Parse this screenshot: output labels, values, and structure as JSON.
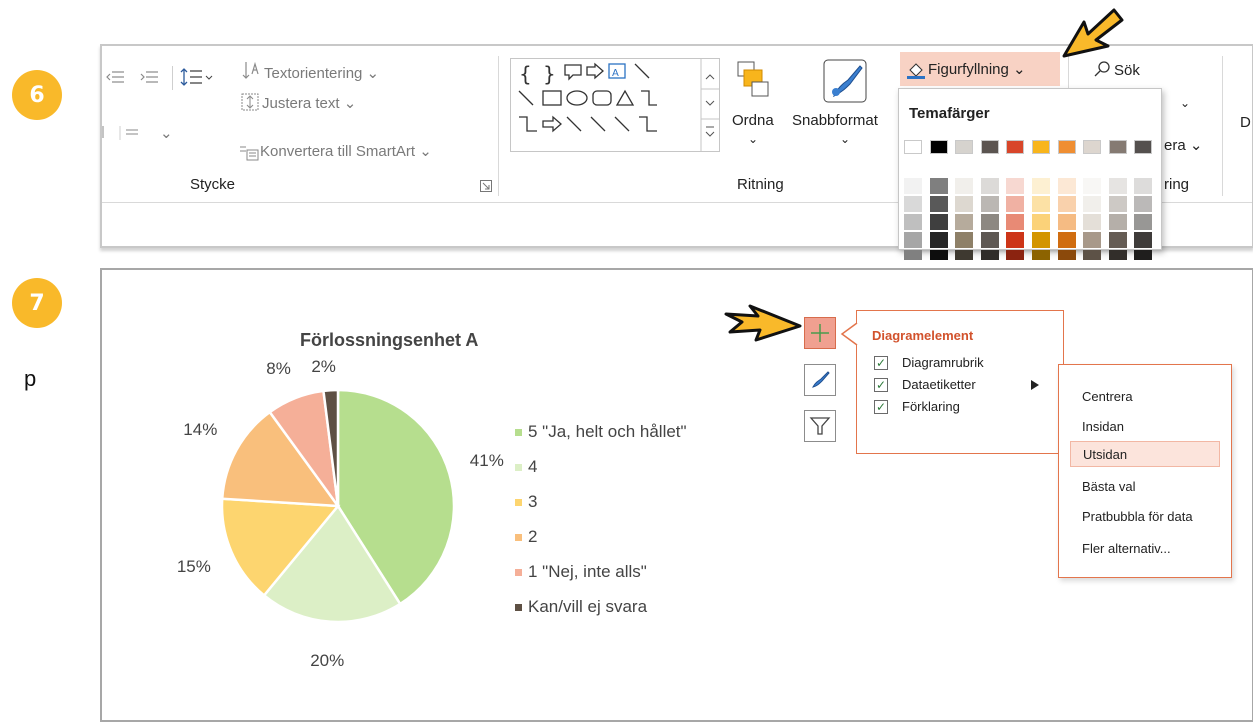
{
  "steps": {
    "six": "6",
    "seven": "7"
  },
  "side_letter": "p",
  "ribbon": {
    "text_direction": "Textorientering",
    "align_text": "Justera text",
    "smartart": "Konvertera till SmartArt",
    "group_paragraph": "Stycke",
    "group_drawing": "Ritning",
    "arrange": "Ordna",
    "quick_styles": "Snabbformat",
    "shape_fill": "Figurfyllning",
    "search": "Sök",
    "partial_era": "era",
    "partial_ring": "ring",
    "partial_d": "D"
  },
  "fill_menu": {
    "title": "Temafärger",
    "theme_colors": [
      "#ffffff",
      "#000000",
      "#d6d3ce",
      "#5b5450",
      "#d8462a",
      "#f8b51c",
      "#ef8e32",
      "#ddd6cf",
      "#857a72",
      "#54504e"
    ],
    "shade_columns": [
      [
        "#f2f2f2",
        "#d9d9d9",
        "#bfbfbf",
        "#a6a6a6",
        "#808080"
      ],
      [
        "#7f7f7f",
        "#595959",
        "#3f3f3f",
        "#262626",
        "#0d0d0d"
      ],
      [
        "#f1efeb",
        "#ddd8d0",
        "#b6ab9c",
        "#8e8068",
        "#3e3930"
      ],
      [
        "#dcdad8",
        "#bbb7b3",
        "#8d8882",
        "#5e5853",
        "#2f2c29"
      ],
      [
        "#f7d8d1",
        "#f0b1a3",
        "#e88a75",
        "#cd3518",
        "#8b2310"
      ],
      [
        "#fdf0d2",
        "#fce1a5",
        "#fbd279",
        "#d39500",
        "#8c6300"
      ],
      [
        "#fce8d5",
        "#f9d1ac",
        "#f5bb83",
        "#d06d10",
        "#8b490b"
      ],
      [
        "#f8f7f5",
        "#f1efeb",
        "#e4dfd8",
        "#a8998a",
        "#5d5247"
      ],
      [
        "#e6e4e2",
        "#cdc9c5",
        "#b5afa9",
        "#655c54",
        "#322e2a"
      ],
      [
        "#dddcdb",
        "#bbb9b8",
        "#989795",
        "#3f3c3a",
        "#1f1e1d"
      ]
    ]
  },
  "chart_data": {
    "type": "pie",
    "title": "Förlossningsenhet A",
    "categories": [
      "5 \"Ja, helt och hållet\"",
      "4",
      "3",
      "2",
      "1 \"Nej, inte alls\"",
      "Kan/vill ej svara"
    ],
    "values": [
      41,
      20,
      15,
      14,
      8,
      2
    ],
    "labels": [
      "41%",
      "20%",
      "15%",
      "14%",
      "8%",
      "2%"
    ],
    "colors": [
      "#b6de8e",
      "#dcefc6",
      "#fdd56f",
      "#f9bf7c",
      "#f5af98",
      "#5e5044"
    ],
    "legend_position": "right"
  },
  "chart_elements": {
    "title": "Diagramelement",
    "items": [
      {
        "label": "Diagramrubrik",
        "checked": true
      },
      {
        "label": "Dataetiketter",
        "checked": true
      },
      {
        "label": "Förklaring",
        "checked": true
      }
    ]
  },
  "label_menu": {
    "items": [
      "Centrera",
      "Insidan",
      "Utsidan",
      "Bästa val",
      "Pratbubbla för data",
      "Fler alternativ..."
    ],
    "selected": "Utsidan"
  }
}
